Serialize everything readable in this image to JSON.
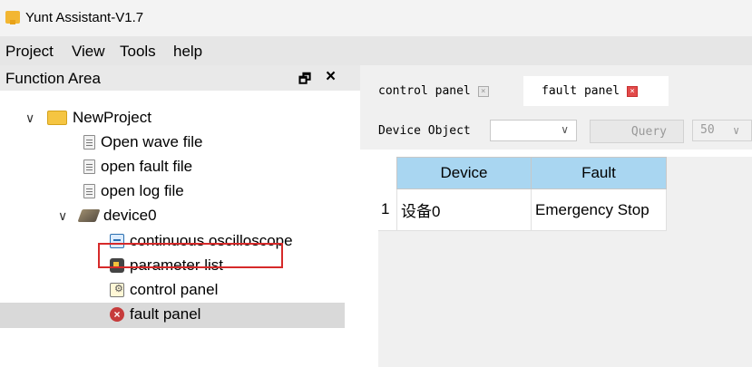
{
  "window": {
    "title": "Yunt Assistant-V1.7"
  },
  "menu": {
    "items": [
      "Project",
      "View",
      "Tools",
      "help"
    ]
  },
  "function_area": {
    "title": "Function Area",
    "tree": {
      "project": "NewProject",
      "project_items": [
        "Open wave file",
        "open fault file",
        "open log file"
      ],
      "device": "device0",
      "device_items": [
        "continuous oscilloscope",
        "parameter list",
        "control panel",
        "fault panel"
      ]
    }
  },
  "tabs": [
    {
      "label": "control panel",
      "active": false
    },
    {
      "label": "fault panel",
      "active": true
    }
  ],
  "toolbar": {
    "device_object_label": "Device Object",
    "device_object_value": "",
    "query_label": "Query",
    "page_size": "50"
  },
  "fault_table": {
    "columns": [
      "Device",
      "Fault"
    ],
    "rows": [
      {
        "index": "1",
        "device": "设备0",
        "fault": "Emergency Stop"
      }
    ]
  },
  "colors": {
    "accent_header": "#a9d6f1",
    "highlight_border": "#d62a2a",
    "active_tab_close": "#e24a4a"
  }
}
